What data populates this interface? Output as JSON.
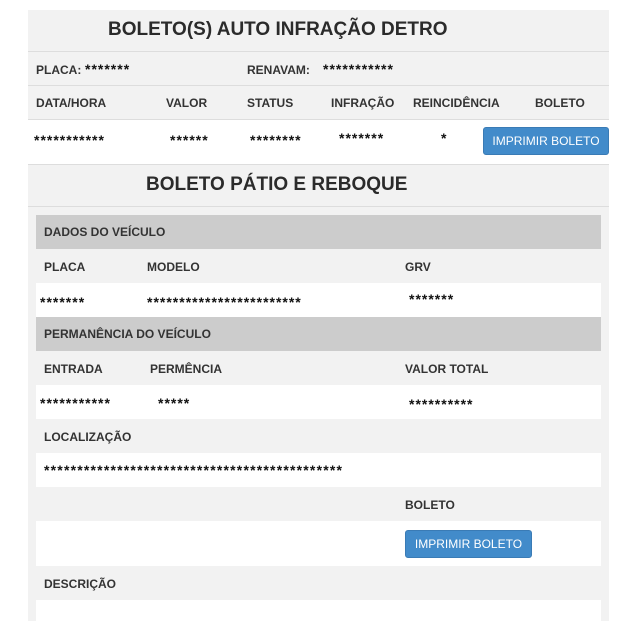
{
  "infracao": {
    "title": "BOLETO(S) AUTO INFRAÇÃO DETRO",
    "placa_label": "PLACA:",
    "placa_value": "*******",
    "renavam_label": "RENAVAM:",
    "renavam_value": "***********",
    "headers": [
      "DATA/HORA",
      "VALOR",
      "STATUS",
      "INFRAÇÃO",
      "REINCIDÊNCIA",
      "BOLETO"
    ],
    "row": [
      "***********",
      "******",
      "********",
      "*******",
      "*"
    ],
    "button": "IMPRIMIR BOLETO"
  },
  "patio": {
    "title": "BOLETO PÁTIO E REBOQUE",
    "dados_title": "DADOS DO VEÍCULO",
    "dados_headers": [
      "PLACA",
      "MODELO",
      "GRV"
    ],
    "dados_row": [
      "*******",
      "************************",
      "*******"
    ],
    "permanencia_title": "PERMANÊNCIA DO VEÍCULO",
    "perm_headers": [
      "ENTRADA",
      "PERMÊNCIA",
      "VALOR TOTAL"
    ],
    "perm_row": [
      "***********",
      "*****",
      "**********"
    ],
    "localizacao_label": "LOCALIZAÇÃO",
    "localizacao_value": "*********************************************",
    "boleto_label": "BOLETO",
    "button": "IMPRIMIR BOLETO",
    "descricao_label": "DESCRIÇÃO"
  }
}
